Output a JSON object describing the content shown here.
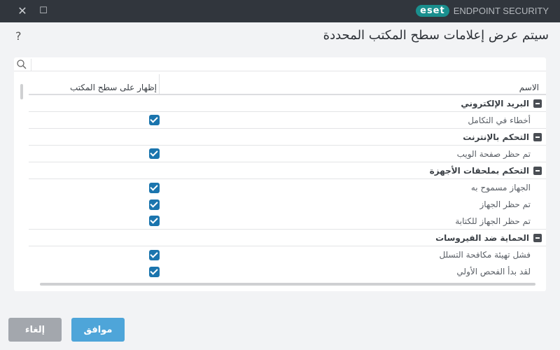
{
  "window": {
    "close_icon": "✕",
    "maximize_icon": "☐",
    "brand_logo": "eset",
    "brand_text": "ENDPOINT SECURITY"
  },
  "help": "?",
  "title": "سيتم عرض إعلامات سطح المكتب المحددة",
  "search": {
    "placeholder": ""
  },
  "columns": {
    "name": "الاسم",
    "show": "إظهار على سطح المكتب"
  },
  "groups": [
    {
      "label": "البريد الإلكتروني",
      "items": [
        {
          "label": "أخطاء في التكامل",
          "checked": true
        }
      ]
    },
    {
      "label": "التحكم بالإنترنت",
      "items": [
        {
          "label": "تم حظر صفحة الويب",
          "checked": true
        }
      ]
    },
    {
      "label": "التحكم بملحقات الأجهزة",
      "items": [
        {
          "label": "الجهاز مسموح به",
          "checked": true
        },
        {
          "label": "تم حظر الجهاز",
          "checked": true
        },
        {
          "label": "تم حظر الجهاز للكتابة",
          "checked": true
        }
      ]
    },
    {
      "label": "الحماية ضد الفيروسات",
      "items": [
        {
          "label": "فشل تهيئة مكافحة التسلل",
          "checked": true
        },
        {
          "label": "لقد بدأ الفحص الأولي",
          "checked": true
        }
      ]
    }
  ],
  "buttons": {
    "ok": "موافق",
    "cancel": "إلغاء"
  }
}
